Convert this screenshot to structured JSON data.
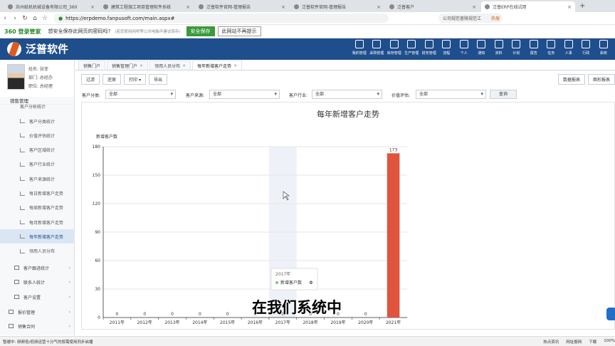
{
  "browser": {
    "tabs": [
      {
        "label": "苏州纸机机械设备有限公司_360",
        "active": false
      },
      {
        "label": "建筑工程施工项目管理软件系统",
        "active": false
      },
      {
        "label": "泛普软件官网-管理报告",
        "active": false
      },
      {
        "label": "泛普软件官网-管理报告",
        "active": false
      },
      {
        "label": "泛普客户",
        "active": false
      },
      {
        "label": "泛普ERP在线试用",
        "active": true
      }
    ],
    "url": "https://erpdemo.fanpusoft.com/main.aspx#",
    "right_search": "公司规范普陵规范江",
    "hot_label": "热搜"
  },
  "notice": {
    "brand": "360 登录管家",
    "question": "想安全保存此网页的密码吗?",
    "hint": "(若您使用网吧等公共电脑不建议保存)",
    "save_label": "安全保存",
    "dismiss_label": "此网站不再提示"
  },
  "app": {
    "logo_text": "泛普软件",
    "modules": [
      {
        "label": "我的管理",
        "icon": "home-icon"
      },
      {
        "label": "采购管理",
        "icon": "cart-icon"
      },
      {
        "label": "库存管理",
        "icon": "box-icon"
      },
      {
        "label": "生产管理",
        "icon": "wrench-icon"
      },
      {
        "label": "财务管理",
        "icon": "money-icon"
      },
      {
        "label": "流程",
        "icon": "flow-icon"
      },
      {
        "label": "个人",
        "icon": "person-icon"
      },
      {
        "label": "通知",
        "icon": "speaker-icon"
      },
      {
        "label": "资料",
        "icon": "doc-icon"
      },
      {
        "label": "计划",
        "icon": "plan-icon"
      },
      {
        "label": "报告",
        "icon": "report-icon"
      },
      {
        "label": "任务",
        "icon": "task-icon"
      },
      {
        "label": "人事",
        "icon": "user-icon"
      },
      {
        "label": "行政",
        "icon": "layers-icon"
      },
      {
        "label": "系统",
        "icon": "gear-icon"
      }
    ]
  },
  "user": {
    "name_label": "姓名: 张菲",
    "dept_label": "部门: 总经办",
    "role_label": "职位: 总经理"
  },
  "sidebar": {
    "section": "销售管理",
    "cut_item": "客户分析统计",
    "items": [
      {
        "label": "客户分类统计",
        "active": false
      },
      {
        "label": "价值评估统计",
        "active": false
      },
      {
        "label": "客户区域统计",
        "active": false
      },
      {
        "label": "客户行业统计",
        "active": false
      },
      {
        "label": "客户来源统计",
        "active": false
      },
      {
        "label": "每日新增客户走势",
        "active": false
      },
      {
        "label": "每周新增客户走势",
        "active": false
      },
      {
        "label": "每月新增客户走势",
        "active": false
      },
      {
        "label": "每年新增客户走势",
        "active": true
      },
      {
        "label": "领用人员分布",
        "active": false
      }
    ],
    "groups": [
      {
        "label": "客户跟进统计"
      },
      {
        "label": "联系人统计"
      },
      {
        "label": "客户设置"
      },
      {
        "label": "报价管理"
      },
      {
        "label": "销售合同"
      }
    ]
  },
  "page_tabs": [
    {
      "label": "销售门户",
      "active": false,
      "closable": false
    },
    {
      "label": "销售管理门户",
      "active": false,
      "closable": true
    },
    {
      "label": "领用人员分布",
      "active": false,
      "closable": true
    },
    {
      "label": "每年新增客户走势",
      "active": true,
      "closable": true
    }
  ],
  "toolbar": {
    "filter_label": "过滤",
    "reset_label": "还原",
    "print_label": "打印 ▾",
    "export_label": "导出",
    "report_label": "数据报表",
    "graph_label": "图形报表"
  },
  "filters": [
    {
      "label": "客户分类:",
      "value": "全部"
    },
    {
      "label": "客户来源:",
      "value": "全部"
    },
    {
      "label": "客户行业:",
      "value": "全部"
    },
    {
      "label": "价值评估:",
      "value": "全部"
    }
  ],
  "query_label": "查询",
  "subtitle": "在我们系统中",
  "chart_data": {
    "type": "bar",
    "title": "每年新增客户走势",
    "ylabel": "新增客户数",
    "categories": [
      "2011年",
      "2012年",
      "2013年",
      "2014年",
      "2015年",
      "2016年",
      "2017年",
      "2018年",
      "2019年",
      "2020年",
      "2021年"
    ],
    "series": [
      {
        "name": "新增客户数",
        "values": [
          0,
          0,
          0,
          0,
          0,
          0,
          0,
          0,
          0,
          0,
          173
        ]
      }
    ],
    "ylim": [
      0,
      180
    ],
    "yticks": [
      0,
      30,
      60,
      90,
      120,
      150,
      180
    ],
    "bar_color": "#e0533c",
    "grid": true,
    "tooltip": {
      "title": "2017年",
      "series": "新增客户数",
      "value": "0"
    }
  },
  "status": {
    "left": "暂缓中: 频频低/低频运营十分气的按需使用同步启播",
    "right": [
      "热点资讯",
      "网址报网",
      "下载",
      "100%"
    ]
  }
}
